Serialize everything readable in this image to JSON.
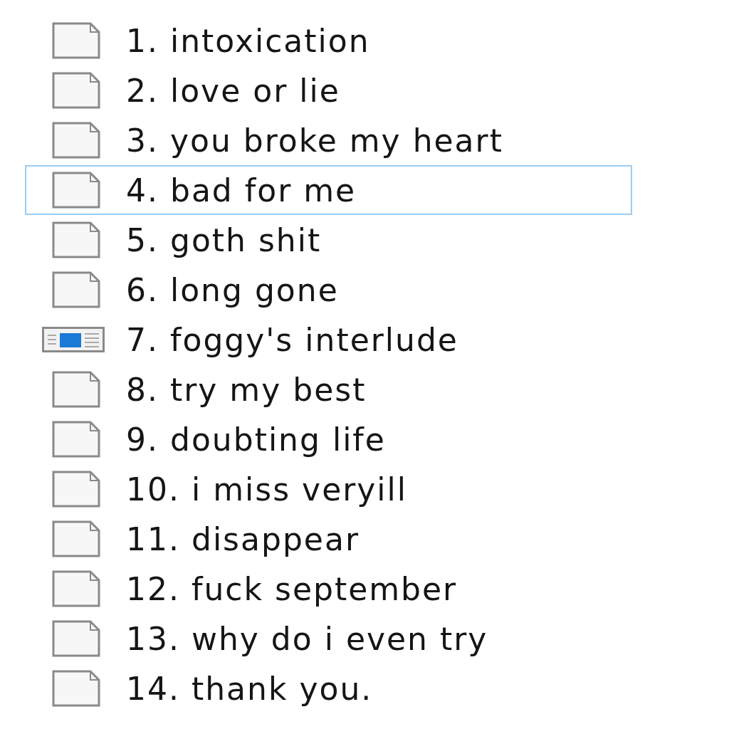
{
  "files": [
    {
      "name": "1. intoxication",
      "kind": "file",
      "focused": false
    },
    {
      "name": "2. love or lie",
      "kind": "file",
      "focused": false
    },
    {
      "name": "3. you broke my heart",
      "kind": "file",
      "focused": false
    },
    {
      "name": "4. bad for me",
      "kind": "file",
      "focused": true
    },
    {
      "name": "5. goth shit",
      "kind": "file",
      "focused": false
    },
    {
      "name": "6. long gone",
      "kind": "file",
      "focused": false
    },
    {
      "name": "7. foggy's interlude",
      "kind": "window",
      "focused": false
    },
    {
      "name": "8. try my best",
      "kind": "file",
      "focused": false
    },
    {
      "name": "9. doubting life",
      "kind": "file",
      "focused": false
    },
    {
      "name": "10. i miss veryill",
      "kind": "file",
      "focused": false
    },
    {
      "name": "11. disappear",
      "kind": "file",
      "focused": false
    },
    {
      "name": "12. fuck september",
      "kind": "file",
      "focused": false
    },
    {
      "name": "13. why do i even try",
      "kind": "file",
      "focused": false
    },
    {
      "name": "14. thank you.",
      "kind": "file",
      "focused": false
    }
  ]
}
